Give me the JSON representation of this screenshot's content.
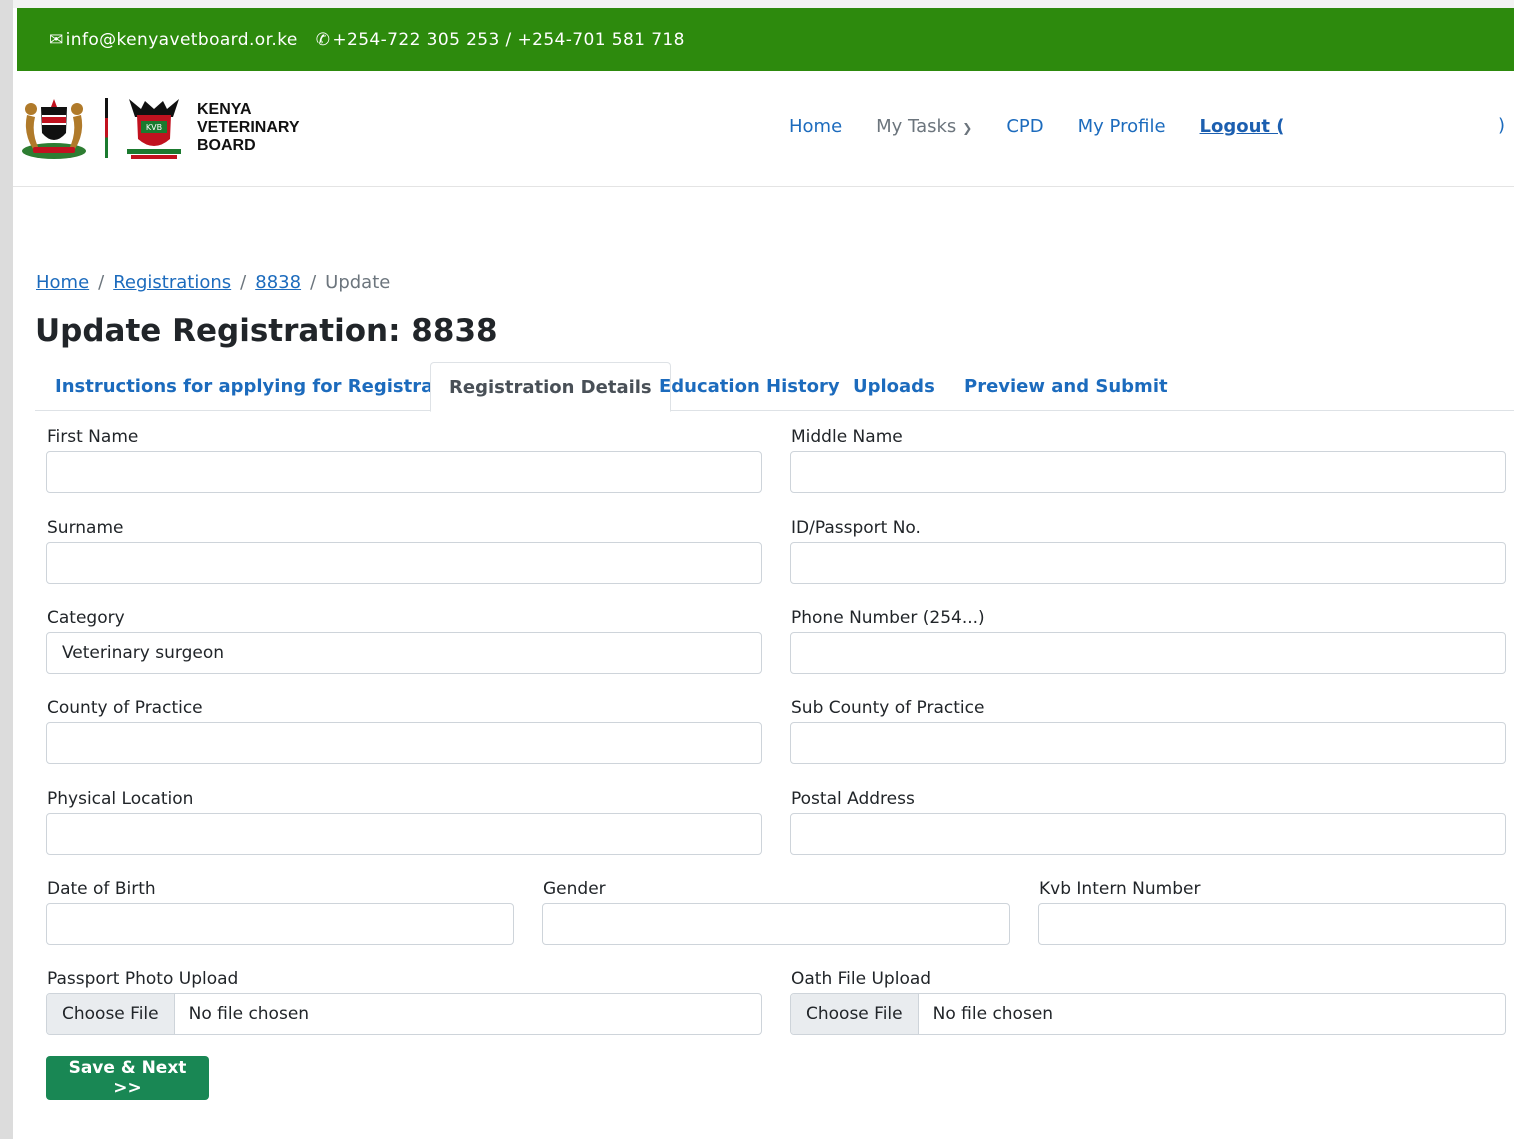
{
  "topbar": {
    "email": "info@kenyavetboard.or.ke",
    "phones": "+254-722 305 253 / +254-701 581 718",
    "bg_color": "#2d8a0d"
  },
  "brand": {
    "line1": "KENYA",
    "line2": "VETERINARY",
    "line3": "BOARD"
  },
  "nav": {
    "home": "Home",
    "my_tasks": "My Tasks",
    "cpd": "CPD",
    "my_profile": "My Profile",
    "logout": "Logout (",
    "logout_close": ")"
  },
  "breadcrumb": {
    "home": "Home",
    "registrations": "Registrations",
    "id": "8838",
    "current": "Update",
    "separator": "/"
  },
  "page": {
    "title": "Update Registration: 8838"
  },
  "tabs": [
    {
      "label": "Instructions for applying for Registration"
    },
    {
      "label": "Registration Details"
    },
    {
      "label": "Education History"
    },
    {
      "label": "Uploads"
    },
    {
      "label": "Preview and Submit"
    }
  ],
  "form": {
    "first_name": {
      "label": "First Name",
      "value": ""
    },
    "middle_name": {
      "label": "Middle Name",
      "value": ""
    },
    "surname": {
      "label": "Surname",
      "value": ""
    },
    "id_passport": {
      "label": "ID/Passport No.",
      "value": ""
    },
    "category": {
      "label": "Category",
      "value": "Veterinary surgeon"
    },
    "phone": {
      "label": "Phone Number (254...)",
      "value": ""
    },
    "county": {
      "label": "County of Practice",
      "value": ""
    },
    "sub_county": {
      "label": "Sub County of Practice",
      "value": ""
    },
    "physical_location": {
      "label": "Physical Location",
      "value": ""
    },
    "postal_address": {
      "label": "Postal Address",
      "value": ""
    },
    "dob": {
      "label": "Date of Birth",
      "value": ""
    },
    "gender": {
      "label": "Gender",
      "value": ""
    },
    "intern_number": {
      "label": "Kvb Intern Number",
      "value": ""
    },
    "passport_photo": {
      "label": "Passport Photo Upload",
      "button": "Choose File",
      "status": "No file chosen"
    },
    "oath_file": {
      "label": "Oath File Upload",
      "button": "Choose File",
      "status": "No file chosen"
    }
  },
  "actions": {
    "save_next": "Save & Next >>"
  },
  "colors": {
    "link": "#1c6bbd",
    "save_button": "#198754"
  },
  "icons": {
    "email": "envelope-icon",
    "phone": "phone-icon",
    "dropdown": "chevron-down-icon"
  }
}
